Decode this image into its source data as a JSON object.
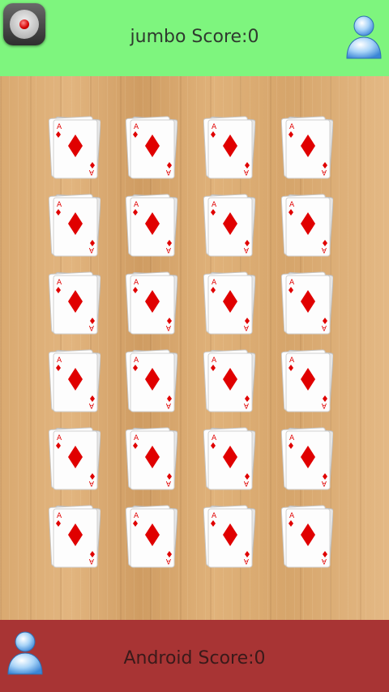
{
  "top_player": {
    "name": "jumbo",
    "score_label": "jumbo Score:0",
    "score": 0
  },
  "bottom_player": {
    "name": "Android",
    "score_label": "Android Score:0",
    "score": 0
  },
  "colors": {
    "top_bar": "#7ef57e",
    "bottom_bar": "#a83434",
    "card_suit": "#e00000"
  },
  "icons": {
    "record": "record-button-icon",
    "avatar": "user-avatar-icon",
    "card": "ace-of-diamonds-card"
  },
  "board": {
    "rows": 6,
    "columns": 4,
    "card_rank": "A"
  }
}
